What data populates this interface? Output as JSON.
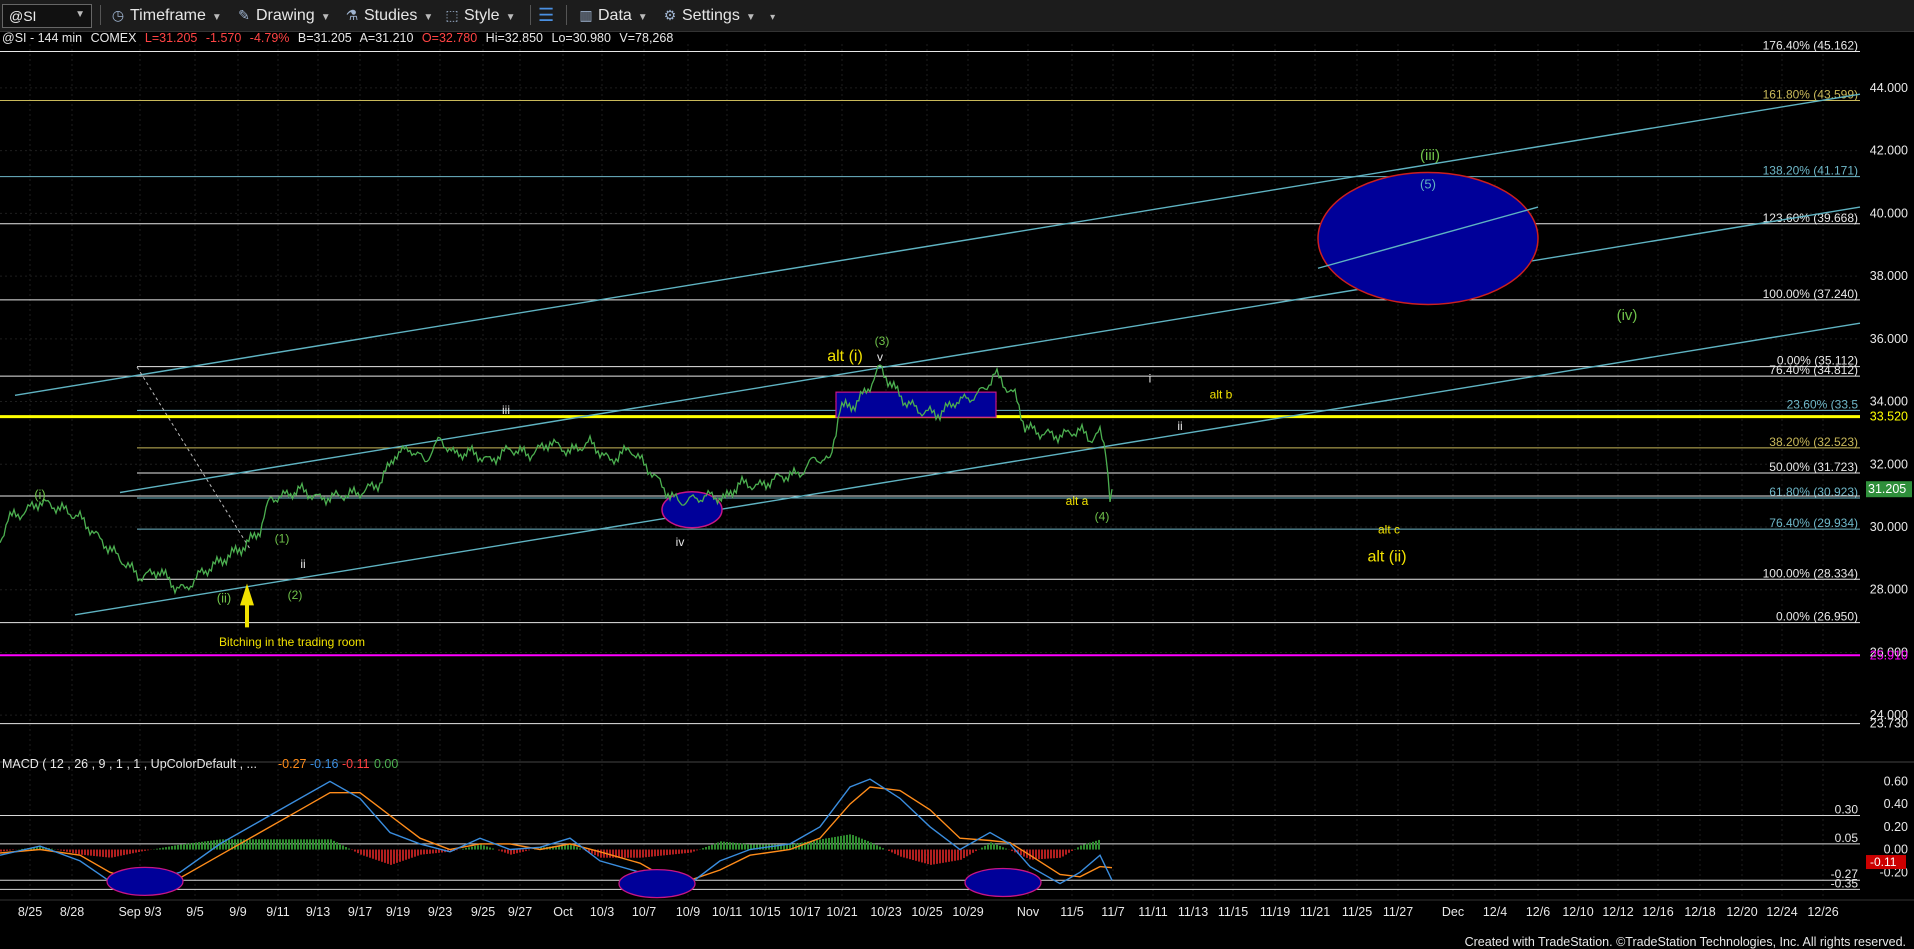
{
  "toolbar": {
    "symbol": "@SI",
    "items": [
      {
        "label": "Timeframe",
        "icon": "timeframe-icon"
      },
      {
        "label": "Drawing",
        "icon": "drawing-icon"
      },
      {
        "label": "Studies",
        "icon": "studies-icon"
      },
      {
        "label": "Style",
        "icon": "style-icon"
      },
      {
        "label": "Data",
        "icon": "data-icon"
      },
      {
        "label": "Settings",
        "icon": "settings-icon"
      }
    ],
    "layout_icon": "layout-panes-icon"
  },
  "header": {
    "symbol_info": "@SI - 144 min",
    "exchange": "COMEX",
    "last": "L=31.205",
    "change": "-1.570",
    "change_pct": "-4.79%",
    "bid": "B=31.205",
    "ask": "A=31.210",
    "open": "O=32.780",
    "high": "Hi=32.850",
    "low": "Lo=30.980",
    "volume": "V=78,268"
  },
  "colors": {
    "price": "#4caf50",
    "channel": "#5fb3c2",
    "fib": "#e8e8e8",
    "yellow": "#ffff00",
    "magenta": "#ff00ff",
    "label_green": "#6fc24a",
    "label_yellow": "#f2e200",
    "target_fill": "#000099",
    "target_stroke": "#cc1f1f"
  },
  "chart_data": {
    "type": "line",
    "symbol": "@SI",
    "interval": "144 min",
    "ylim": [
      23.4,
      45.4
    ],
    "y_ticks": [
      24.0,
      26.0,
      28.0,
      30.0,
      32.0,
      34.0,
      36.0,
      38.0,
      40.0,
      42.0,
      44.0
    ],
    "y_tick_labels": [
      "24.000",
      "26.000",
      "28.000",
      "30.000",
      "32.000",
      "34.000",
      "36.000",
      "38.000",
      "40.000",
      "42.000",
      "44.000"
    ],
    "x_tick_labels": [
      "8/25",
      "8/28",
      "Sep 9/3",
      "9/5",
      "9/9",
      "9/11",
      "9/13",
      "9/17",
      "9/19",
      "9/23",
      "9/25",
      "9/27",
      "Oct",
      "10/3",
      "10/7",
      "10/9",
      "10/11",
      "10/15",
      "10/17",
      "10/21",
      "10/23",
      "10/25",
      "10/29",
      "Nov",
      "11/5",
      "11/7",
      "11/11",
      "11/13",
      "11/15",
      "11/19",
      "11/21",
      "11/25",
      "11/27",
      "Dec",
      "12/4",
      "12/6",
      "12/10",
      "12/12",
      "12/16",
      "12/18",
      "12/20",
      "12/24",
      "12/26"
    ],
    "price_series": {
      "name": "@SI",
      "points": [
        [
          0,
          29.5
        ],
        [
          8,
          30.3
        ],
        [
          20,
          30.4
        ],
        [
          40,
          30.8
        ],
        [
          60,
          30.6
        ],
        [
          80,
          30.3
        ],
        [
          100,
          29.6
        ],
        [
          120,
          29.0
        ],
        [
          140,
          28.4
        ],
        [
          160,
          28.6
        ],
        [
          175,
          28.1
        ],
        [
          185,
          28.0
        ],
        [
          200,
          28.5
        ],
        [
          215,
          28.8
        ],
        [
          230,
          29.1
        ],
        [
          245,
          29.4
        ],
        [
          260,
          29.9
        ],
        [
          270,
          30.9
        ],
        [
          285,
          31.0
        ],
        [
          300,
          31.2
        ],
        [
          320,
          30.9
        ],
        [
          340,
          31.0
        ],
        [
          360,
          31.1
        ],
        [
          380,
          31.4
        ],
        [
          395,
          32.3
        ],
        [
          410,
          32.5
        ],
        [
          425,
          32.1
        ],
        [
          440,
          32.8
        ],
        [
          455,
          32.3
        ],
        [
          470,
          32.4
        ],
        [
          490,
          32.1
        ],
        [
          510,
          32.5
        ],
        [
          530,
          32.3
        ],
        [
          550,
          32.7
        ],
        [
          570,
          32.4
        ],
        [
          590,
          32.7
        ],
        [
          610,
          32.1
        ],
        [
          630,
          32.5
        ],
        [
          650,
          31.8
        ],
        [
          670,
          31.0
        ],
        [
          680,
          30.8
        ],
        [
          695,
          30.9
        ],
        [
          710,
          31.0
        ],
        [
          725,
          30.9
        ],
        [
          740,
          31.4
        ],
        [
          760,
          31.3
        ],
        [
          780,
          31.6
        ],
        [
          800,
          31.7
        ],
        [
          815,
          32.2
        ],
        [
          830,
          32.1
        ],
        [
          840,
          33.8
        ],
        [
          855,
          33.9
        ],
        [
          870,
          34.5
        ],
        [
          880,
          35.1
        ],
        [
          890,
          34.6
        ],
        [
          905,
          34.0
        ],
        [
          920,
          33.7
        ],
        [
          940,
          33.6
        ],
        [
          955,
          34.0
        ],
        [
          970,
          34.1
        ],
        [
          985,
          34.4
        ],
        [
          995,
          34.9
        ],
        [
          1005,
          34.5
        ],
        [
          1015,
          34.2
        ],
        [
          1025,
          33.2
        ],
        [
          1040,
          33.0
        ],
        [
          1060,
          32.9
        ],
        [
          1080,
          33.1
        ],
        [
          1090,
          32.8
        ],
        [
          1100,
          33.0
        ],
        [
          1106,
          32.4
        ],
        [
          1110,
          30.98
        ],
        [
          1112,
          31.205
        ]
      ]
    },
    "y_axis_markers": [
      {
        "label": "44.000",
        "value": 44.0
      },
      {
        "label": "31.205",
        "value": 31.205,
        "color": "#2f8f3b"
      },
      {
        "label": "25.910",
        "value": 25.91,
        "color": "#ff00ff"
      },
      {
        "label": "23.730",
        "value": 23.73
      },
      {
        "label": "33.520",
        "value": 33.52,
        "color": "#ffff00"
      }
    ],
    "fib_levels": [
      {
        "label": "176.40% (45.162)",
        "value": 45.162,
        "color": "#e8e8e8"
      },
      {
        "label": "161.80% (43.599)",
        "value": 43.599,
        "color": "#c9b95a"
      },
      {
        "label": "138.20% (41.171)",
        "value": 41.171,
        "color": "#6fb8c9"
      },
      {
        "label": "123.60% (39.668)",
        "value": 39.668,
        "color": "#e8e8e8"
      },
      {
        "label": "100.00% (37.240)",
        "value": 37.24,
        "color": "#e8e8e8"
      },
      {
        "label": "0.00% (35.112)",
        "value": 35.112,
        "color": "#e8e8e8"
      },
      {
        "label": "76.40% (34.812)",
        "value": 34.812,
        "color": "#e8e8e8"
      },
      {
        "label": "23.60% (33.5",
        "value": 33.72,
        "color": "#6fb8c9"
      },
      {
        "label": "38.20% (32.523)",
        "value": 32.523,
        "color": "#c9b95a"
      },
      {
        "label": "50.00% (31.723)",
        "value": 31.723,
        "color": "#e8e8e8"
      },
      {
        "label": "61.80% (30.923)",
        "value": 30.923,
        "color": "#6fb8c9"
      },
      {
        "label": "76.40% (29.934)",
        "value": 29.934,
        "color": "#6fb8c9"
      },
      {
        "label": "100.00% (28.334)",
        "value": 28.334,
        "color": "#e8e8e8"
      },
      {
        "label": "0.00% (26.950)",
        "value": 26.95,
        "color": "#e8e8e8"
      }
    ],
    "annotations": [
      {
        "text": "(i)",
        "color": "green"
      },
      {
        "text": "(ii)",
        "color": "green"
      },
      {
        "text": "(1)",
        "color": "green"
      },
      {
        "text": "(2)",
        "color": "green"
      },
      {
        "text": "ii",
        "color": "white"
      },
      {
        "text": "iii",
        "color": "white"
      },
      {
        "text": "iv",
        "color": "white"
      },
      {
        "text": "v",
        "color": "white"
      },
      {
        "text": "(3)",
        "color": "green"
      },
      {
        "text": "alt (i)",
        "color": "yellow"
      },
      {
        "text": "(iii)",
        "color": "green"
      },
      {
        "text": "(5)",
        "color": "cyan"
      },
      {
        "text": "(iv)",
        "color": "green"
      },
      {
        "text": "i",
        "color": "white"
      },
      {
        "text": "alt b",
        "color": "yellow"
      },
      {
        "text": "ii",
        "color": "white"
      },
      {
        "text": "alt a",
        "color": "yellow"
      },
      {
        "text": "(4)",
        "color": "green"
      },
      {
        "text": "alt c",
        "color": "yellow"
      },
      {
        "text": "alt (ii)",
        "color": "yellow"
      },
      {
        "text": "Bitching in the trading room",
        "color": "yellow"
      }
    ],
    "macd": {
      "label": "MACD ( 12 , 26 , 9 , 1 , 1 , UpColorDefault , ...",
      "values_text": [
        {
          "text": "-0.27",
          "color": "#ff8c1a"
        },
        {
          "text": "-0.16",
          "color": "#3a8dde"
        },
        {
          "text": "-0.11",
          "color": "#ff4040"
        },
        {
          "text": "0.00",
          "color": "#4caf50"
        }
      ],
      "ylim": [
        -0.4,
        0.7
      ],
      "y_tick_labels": [
        "0.60",
        "0.40",
        "0.20",
        "0.00",
        "-0.20"
      ],
      "y_ticks": [
        0.6,
        0.4,
        0.2,
        0.0,
        -0.2
      ],
      "ref_levels": [
        {
          "label": "0.30",
          "value": 0.3
        },
        {
          "label": "0.05",
          "value": 0.05
        },
        {
          "label": "-0.27",
          "value": -0.27
        },
        {
          "label": "-0.35",
          "value": -0.35
        }
      ],
      "markers": [
        {
          "label": "-0.11",
          "value": -0.11,
          "color": "#cc0000"
        }
      ],
      "macd_line": [
        [
          0,
          -0.05
        ],
        [
          40,
          0.03
        ],
        [
          80,
          -0.1
        ],
        [
          110,
          -0.28
        ],
        [
          140,
          -0.3
        ],
        [
          180,
          -0.2
        ],
        [
          220,
          0.05
        ],
        [
          260,
          0.25
        ],
        [
          300,
          0.45
        ],
        [
          330,
          0.6
        ],
        [
          360,
          0.45
        ],
        [
          390,
          0.15
        ],
        [
          420,
          0.05
        ],
        [
          450,
          -0.02
        ],
        [
          480,
          0.1
        ],
        [
          510,
          0.0
        ],
        [
          540,
          0.02
        ],
        [
          570,
          0.1
        ],
        [
          600,
          -0.1
        ],
        [
          640,
          -0.2
        ],
        [
          660,
          -0.28
        ],
        [
          690,
          -0.3
        ],
        [
          720,
          -0.1
        ],
        [
          750,
          0.0
        ],
        [
          790,
          0.05
        ],
        [
          820,
          0.2
        ],
        [
          850,
          0.55
        ],
        [
          870,
          0.62
        ],
        [
          900,
          0.45
        ],
        [
          930,
          0.2
        ],
        [
          960,
          0.0
        ],
        [
          990,
          0.15
        ],
        [
          1010,
          0.05
        ],
        [
          1030,
          -0.15
        ],
        [
          1060,
          -0.3
        ],
        [
          1080,
          -0.2
        ],
        [
          1100,
          -0.05
        ],
        [
          1112,
          -0.27
        ]
      ],
      "signal_line": [
        [
          0,
          -0.03
        ],
        [
          40,
          0.0
        ],
        [
          80,
          -0.05
        ],
        [
          110,
          -0.2
        ],
        [
          140,
          -0.28
        ],
        [
          180,
          -0.25
        ],
        [
          220,
          -0.05
        ],
        [
          260,
          0.15
        ],
        [
          300,
          0.35
        ],
        [
          330,
          0.5
        ],
        [
          360,
          0.5
        ],
        [
          390,
          0.3
        ],
        [
          420,
          0.1
        ],
        [
          450,
          0.0
        ],
        [
          480,
          0.05
        ],
        [
          510,
          0.05
        ],
        [
          540,
          0.0
        ],
        [
          570,
          0.05
        ],
        [
          600,
          -0.02
        ],
        [
          640,
          -0.12
        ],
        [
          660,
          -0.22
        ],
        [
          690,
          -0.27
        ],
        [
          720,
          -0.18
        ],
        [
          750,
          -0.05
        ],
        [
          790,
          0.0
        ],
        [
          820,
          0.1
        ],
        [
          850,
          0.4
        ],
        [
          870,
          0.55
        ],
        [
          900,
          0.52
        ],
        [
          930,
          0.35
        ],
        [
          960,
          0.1
        ],
        [
          990,
          0.08
        ],
        [
          1010,
          0.06
        ],
        [
          1030,
          -0.05
        ],
        [
          1060,
          -0.22
        ],
        [
          1080,
          -0.24
        ],
        [
          1100,
          -0.15
        ],
        [
          1112,
          -0.16
        ]
      ]
    }
  },
  "footer": {
    "credit": "Created with TradeStation. ©TradeStation Technologies, Inc. All rights reserved."
  }
}
